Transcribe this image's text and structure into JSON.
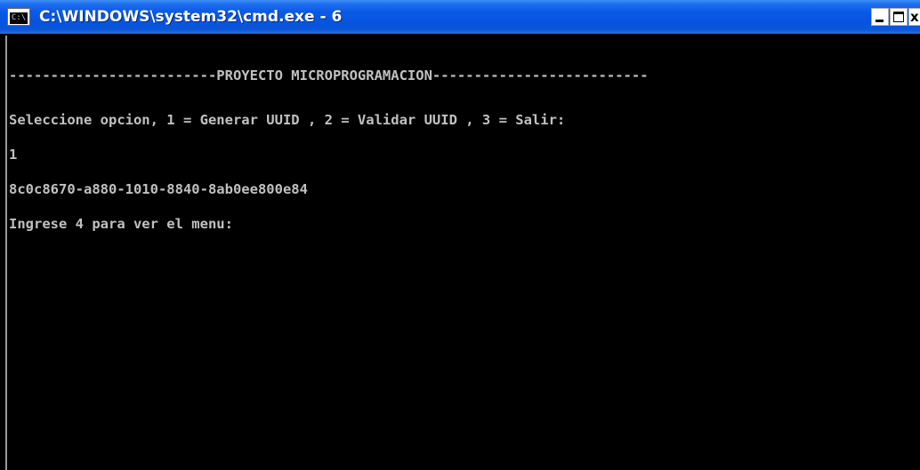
{
  "window": {
    "title": "C:\\WINDOWS\\system32\\cmd.exe - 6",
    "icon_label": "C:\\",
    "icon": "cmd-icon",
    "controls": {
      "minimize": "minimize-icon",
      "maximize": "maximize-icon",
      "close_glyph": "x"
    }
  },
  "console": {
    "lines": [
      "-------------------------PROYECTO MICROPROGRAMACION--------------------------",
      "Seleccione opcion, 1 = Generar UUID , 2 = Validar UUID , 3 = Salir:",
      "1",
      "8c0c8670-a880-1010-8840-8ab0ee800e84",
      "Ingrese 4 para ver el menu:"
    ],
    "text_color": "#c0c0c0",
    "background": "#000000"
  }
}
